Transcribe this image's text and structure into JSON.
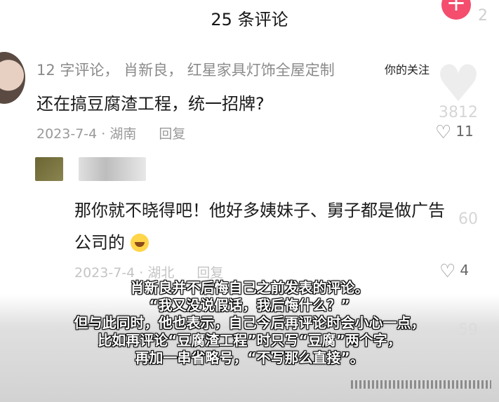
{
  "header": {
    "title": "25 条评论",
    "corner_count": "2",
    "plus_label": "+"
  },
  "comments": [
    {
      "meta": "12 字评论，   肖新良，   红星家具灯饰全屋定制",
      "tag": "你的关注",
      "text": "还在搞豆腐渣工程，统一招牌?",
      "date": "2023-7-4 · 湖南",
      "reply": "回复",
      "likes": "11"
    },
    {
      "text_line1": "那你就不晓得吧！他好多姨妹子、舅子都是做广告",
      "text_line2": "公司的",
      "date": "2023-7-4 · 湖北",
      "reply": "回复",
      "likes": "4"
    }
  ],
  "side_counts": {
    "first": "3812",
    "second": "60",
    "third": "59"
  },
  "subtitles": [
    "肖新良并不后悔自己之前发表的评论。",
    "“我又没说假话，我后悔什么？”",
    "但与此同时，他也表示，自己今后再评论时会小心一点，",
    "比如再评论“豆腐渣工程”时只写“豆腐”两个字，",
    "再加一串省略号，“不写那么直接”。"
  ],
  "colors": {
    "accent": "#f44d6e",
    "text_primary": "#1a1a1a",
    "text_secondary": "#999999"
  }
}
